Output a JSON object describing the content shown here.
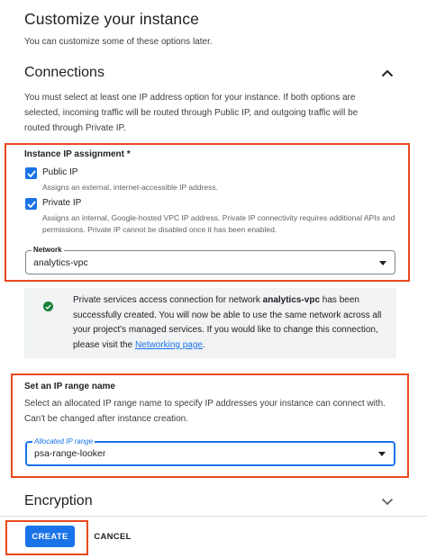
{
  "header": {
    "title": "Customize your instance",
    "subtitle": "You can customize some of these options later."
  },
  "connections": {
    "title": "Connections",
    "collapse_icon": "chevron-up-icon",
    "description": "You must select at least one IP address option for your instance. If both options are selected, incoming traffic will be routed through Public IP, and outgoing traffic will be routed through Private IP.",
    "ip_assignment": {
      "label": "Instance IP assignment *",
      "public_ip": {
        "label": "Public IP",
        "checked": true,
        "help": "Assigns an external, internet-accessible IP address."
      },
      "private_ip": {
        "label": "Private IP",
        "checked": true,
        "help": "Assigns an internal, Google-hosted VPC IP address. Private IP connectivity requires additional APIs and permissions. Private IP cannot be disabled once it has been enabled."
      }
    },
    "network": {
      "label": "Network",
      "value": "analytics-vpc"
    },
    "info": {
      "icon": "check-circle-icon",
      "text_before": "Private services access connection for network ",
      "network_name": "analytics-vpc",
      "text_after": " has been successfully created. You will now be able to use the same network across all your project's managed services. If you would like to change this connection, please visit the ",
      "link_text": "Networking page",
      "text_end": "."
    },
    "ip_range": {
      "title": "Set an IP range name",
      "description": "Select an allocated IP range name to specify IP addresses your instance can connect with. Can't be changed after instance creation.",
      "field_label": "Allocated IP range",
      "value": "psa-range-looker"
    }
  },
  "encryption": {
    "title": "Encryption",
    "expand_icon": "chevron-down-icon"
  },
  "actions": {
    "create_label": "CREATE",
    "cancel_label": "CANCEL"
  },
  "colors": {
    "primary": "#1a73e8",
    "highlight": "#e8491d",
    "success": "#188038"
  }
}
